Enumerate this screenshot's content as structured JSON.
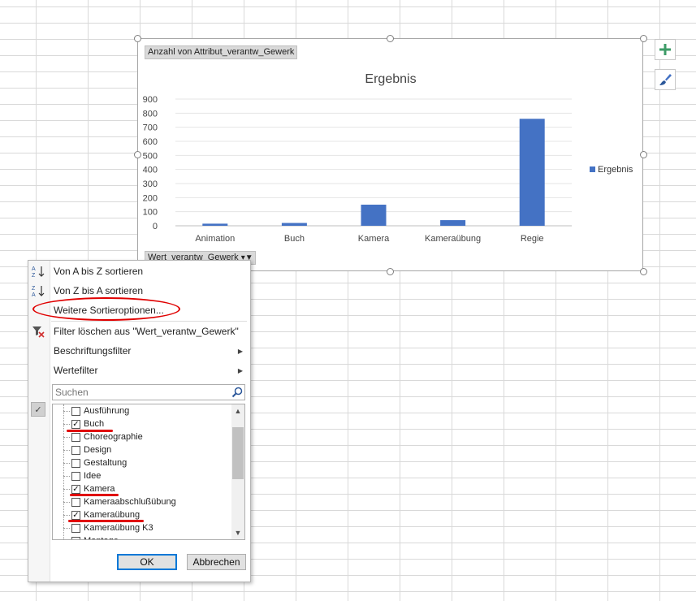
{
  "chart": {
    "pivot_field_label": "Anzahl von Attribut_verantw_Gewerk",
    "axis_field_label": "Wert_verantw_Gewerk",
    "series_color": "#4472c4",
    "chart_data": {
      "type": "bar",
      "title": "Ergebnis",
      "categories": [
        "Animation",
        "Buch",
        "Kamera",
        "Kameraübung",
        "Regie"
      ],
      "series": [
        {
          "name": "Ergebnis",
          "values": [
            15,
            20,
            150,
            40,
            760
          ]
        }
      ],
      "y_ticks": [
        "0",
        "100",
        "200",
        "300",
        "400",
        "500",
        "600",
        "700",
        "800",
        "900"
      ],
      "ylim": [
        0,
        900
      ],
      "grid": true,
      "legend_position": "right"
    },
    "side_buttons": {
      "add_icon": "plus-icon",
      "style_icon": "paintbrush-icon"
    }
  },
  "filter_menu": {
    "items": {
      "sort_az": "Von A bis Z sortieren",
      "sort_za": "Von Z bis A sortieren",
      "more_sort": "Weitere Sortieroptionen...",
      "clear_filter": "Filter löschen aus \"Wert_verantw_Gewerk\"",
      "label_filter": "Beschriftungsfilter",
      "value_filter": "Wertefilter"
    },
    "search": {
      "placeholder": "Suchen"
    },
    "list": [
      {
        "label": "Ausführung",
        "checked": false
      },
      {
        "label": "Buch",
        "checked": true
      },
      {
        "label": "Choreographie",
        "checked": false
      },
      {
        "label": "Design",
        "checked": false
      },
      {
        "label": "Gestaltung",
        "checked": false
      },
      {
        "label": "Idee",
        "checked": false
      },
      {
        "label": "Kamera",
        "checked": true
      },
      {
        "label": "Kameraabschlußübung",
        "checked": false
      },
      {
        "label": "Kameraübung",
        "checked": true
      },
      {
        "label": "Kameraübung K3",
        "checked": false
      },
      {
        "label": "Montage",
        "checked": false
      }
    ],
    "ok_label": "OK",
    "cancel_label": "Abbrechen"
  },
  "annotation_color": "#e00000"
}
